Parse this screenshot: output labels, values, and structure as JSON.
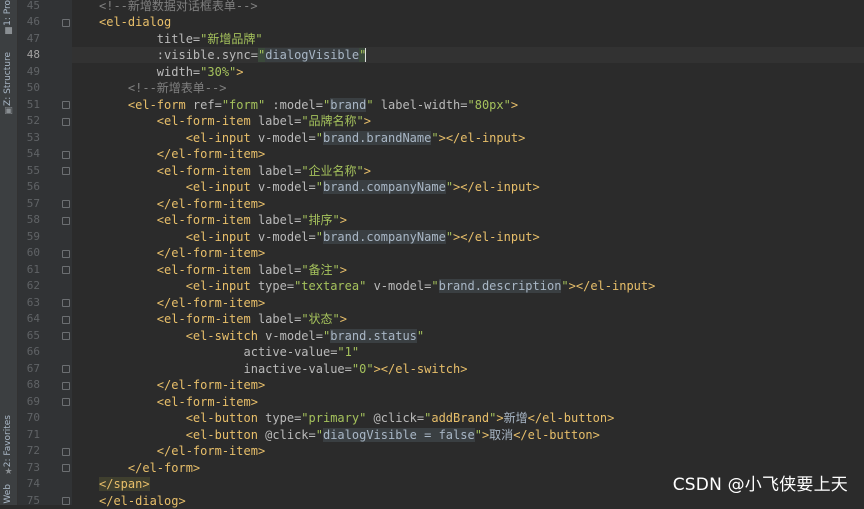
{
  "tool_windows": {
    "project": {
      "label": "1: Pro",
      "icon": "folder-icon"
    },
    "structure": {
      "label": "Z: Structure",
      "icon": "structure-icon"
    },
    "favorites": {
      "label": "2: Favorites",
      "icon": "star-icon"
    },
    "web": {
      "label": "Web",
      "icon": "web-icon"
    }
  },
  "editor": {
    "current_line": "48",
    "lines": [
      {
        "num": "45",
        "tokens": [
          {
            "c": "t-cmt",
            "t": "<!--新增数据对话框表单-->"
          }
        ]
      },
      {
        "num": "46",
        "tokens": [
          {
            "c": "t-tag",
            "t": "<el-dialog"
          }
        ]
      },
      {
        "num": "47",
        "tokens": [
          {
            "c": "t-attr",
            "t": "        title="
          },
          {
            "c": "t-val",
            "t": "\"新增品牌\""
          }
        ]
      },
      {
        "num": "48",
        "tokens": [
          {
            "c": "t-attr",
            "t": "        :visible.sync="
          },
          {
            "c": "t-val hl-val",
            "t": "\""
          },
          {
            "c": "hl-str",
            "t": "dialogVisible"
          },
          {
            "c": "t-val hl-val",
            "t": "\""
          },
          {
            "c": "caret",
            "t": ""
          }
        ]
      },
      {
        "num": "49",
        "tokens": [
          {
            "c": "t-attr",
            "t": "        width="
          },
          {
            "c": "t-val",
            "t": "\"30%\""
          },
          {
            "c": "t-tag",
            "t": ">"
          }
        ]
      },
      {
        "num": "50",
        "tokens": [
          {
            "c": "t-cmt",
            "t": "    <!--新增表单-->"
          }
        ]
      },
      {
        "num": "51",
        "tokens": [
          {
            "c": "t-tag",
            "t": "    <el-form "
          },
          {
            "c": "t-attr",
            "t": "ref="
          },
          {
            "c": "t-val",
            "t": "\"form\" "
          },
          {
            "c": "t-attr",
            "t": ":model="
          },
          {
            "c": "t-val",
            "t": "\""
          },
          {
            "c": "hl-str",
            "t": "brand"
          },
          {
            "c": "t-val",
            "t": "\" "
          },
          {
            "c": "t-attr",
            "t": "label-width="
          },
          {
            "c": "t-val",
            "t": "\"80px\""
          },
          {
            "c": "t-tag",
            "t": ">"
          }
        ]
      },
      {
        "num": "52",
        "tokens": [
          {
            "c": "t-tag",
            "t": "        <el-form-item "
          },
          {
            "c": "t-attr",
            "t": "label="
          },
          {
            "c": "t-val",
            "t": "\"品牌名称\""
          },
          {
            "c": "t-tag",
            "t": ">"
          }
        ]
      },
      {
        "num": "53",
        "tokens": [
          {
            "c": "t-tag",
            "t": "            <el-input "
          },
          {
            "c": "t-attr",
            "t": "v-model="
          },
          {
            "c": "t-val",
            "t": "\""
          },
          {
            "c": "hl-str",
            "t": "brand.brandName"
          },
          {
            "c": "t-val",
            "t": "\""
          },
          {
            "c": "t-tag",
            "t": "></el-input>"
          }
        ]
      },
      {
        "num": "54",
        "tokens": [
          {
            "c": "t-tag",
            "t": "        </el-form-item>"
          }
        ]
      },
      {
        "num": "55",
        "tokens": [
          {
            "c": "t-tag",
            "t": "        <el-form-item "
          },
          {
            "c": "t-attr",
            "t": "label="
          },
          {
            "c": "t-val",
            "t": "\"企业名称\""
          },
          {
            "c": "t-tag",
            "t": ">"
          }
        ]
      },
      {
        "num": "56",
        "tokens": [
          {
            "c": "t-tag",
            "t": "            <el-input "
          },
          {
            "c": "t-attr",
            "t": "v-model="
          },
          {
            "c": "t-val",
            "t": "\""
          },
          {
            "c": "hl-str",
            "t": "brand.companyName"
          },
          {
            "c": "t-val",
            "t": "\""
          },
          {
            "c": "t-tag",
            "t": "></el-input>"
          }
        ]
      },
      {
        "num": "57",
        "tokens": [
          {
            "c": "t-tag",
            "t": "        </el-form-item>"
          }
        ]
      },
      {
        "num": "58",
        "tokens": [
          {
            "c": "t-tag",
            "t": "        <el-form-item "
          },
          {
            "c": "t-attr",
            "t": "label="
          },
          {
            "c": "t-val",
            "t": "\"排序\""
          },
          {
            "c": "t-tag",
            "t": ">"
          }
        ]
      },
      {
        "num": "59",
        "tokens": [
          {
            "c": "t-tag",
            "t": "            <el-input "
          },
          {
            "c": "t-attr",
            "t": "v-model="
          },
          {
            "c": "t-val",
            "t": "\""
          },
          {
            "c": "hl-str",
            "t": "brand.companyName"
          },
          {
            "c": "t-val",
            "t": "\""
          },
          {
            "c": "t-tag",
            "t": "></el-input>"
          }
        ]
      },
      {
        "num": "60",
        "tokens": [
          {
            "c": "t-tag",
            "t": "        </el-form-item>"
          }
        ]
      },
      {
        "num": "61",
        "tokens": [
          {
            "c": "t-tag",
            "t": "        <el-form-item "
          },
          {
            "c": "t-attr",
            "t": "label="
          },
          {
            "c": "t-val",
            "t": "\"备注\""
          },
          {
            "c": "t-tag",
            "t": ">"
          }
        ]
      },
      {
        "num": "62",
        "tokens": [
          {
            "c": "t-tag",
            "t": "            <el-input "
          },
          {
            "c": "t-attr",
            "t": "type="
          },
          {
            "c": "t-val",
            "t": "\"textarea\" "
          },
          {
            "c": "t-attr",
            "t": "v-model="
          },
          {
            "c": "t-val",
            "t": "\""
          },
          {
            "c": "hl-str",
            "t": "brand.description"
          },
          {
            "c": "t-val",
            "t": "\""
          },
          {
            "c": "t-tag",
            "t": "></el-input>"
          }
        ]
      },
      {
        "num": "63",
        "tokens": [
          {
            "c": "t-tag",
            "t": "        </el-form-item>"
          }
        ]
      },
      {
        "num": "64",
        "tokens": [
          {
            "c": "t-tag",
            "t": "        <el-form-item "
          },
          {
            "c": "t-attr",
            "t": "label="
          },
          {
            "c": "t-val",
            "t": "\"状态\""
          },
          {
            "c": "t-tag",
            "t": ">"
          }
        ]
      },
      {
        "num": "65",
        "tokens": [
          {
            "c": "t-tag",
            "t": "            <el-switch "
          },
          {
            "c": "t-attr",
            "t": "v-model="
          },
          {
            "c": "t-val",
            "t": "\""
          },
          {
            "c": "hl-str",
            "t": "brand.status"
          },
          {
            "c": "t-val",
            "t": "\""
          }
        ]
      },
      {
        "num": "66",
        "tokens": [
          {
            "c": "t-attr",
            "t": "                    active-value="
          },
          {
            "c": "t-val",
            "t": "\"1\""
          }
        ]
      },
      {
        "num": "67",
        "tokens": [
          {
            "c": "t-attr",
            "t": "                    inactive-value="
          },
          {
            "c": "t-val",
            "t": "\"0\""
          },
          {
            "c": "t-tag",
            "t": "></el-switch>"
          }
        ]
      },
      {
        "num": "68",
        "tokens": [
          {
            "c": "t-tag",
            "t": "        </el-form-item>"
          }
        ]
      },
      {
        "num": "69",
        "tokens": [
          {
            "c": "t-tag",
            "t": "        <el-form-item>"
          }
        ]
      },
      {
        "num": "70",
        "tokens": [
          {
            "c": "t-tag",
            "t": "            <el-button "
          },
          {
            "c": "t-attr",
            "t": "type="
          },
          {
            "c": "t-val",
            "t": "\"primary\" "
          },
          {
            "c": "t-attr",
            "t": "@click="
          },
          {
            "c": "t-val",
            "t": "\""
          },
          {
            "c": "t-tag",
            "t": "addBrand"
          },
          {
            "c": "t-val",
            "t": "\""
          },
          {
            "c": "t-tag",
            "t": ">"
          },
          {
            "c": "t-txt",
            "t": "新增"
          },
          {
            "c": "t-tag",
            "t": "</el-button>"
          }
        ]
      },
      {
        "num": "71",
        "tokens": [
          {
            "c": "t-tag",
            "t": "            <el-button "
          },
          {
            "c": "t-attr",
            "t": "@click="
          },
          {
            "c": "t-val",
            "t": "\""
          },
          {
            "c": "hl-str",
            "t": "dialogVisible = false"
          },
          {
            "c": "t-val",
            "t": "\""
          },
          {
            "c": "t-tag",
            "t": ">"
          },
          {
            "c": "t-txt",
            "t": "取消"
          },
          {
            "c": "t-tag",
            "t": "</el-button>"
          }
        ]
      },
      {
        "num": "72",
        "tokens": [
          {
            "c": "t-tag",
            "t": "        </el-form-item>"
          }
        ]
      },
      {
        "num": "73",
        "tokens": [
          {
            "c": "t-tag",
            "t": "    </el-form>"
          }
        ]
      },
      {
        "num": "74",
        "tokens": [
          {
            "c": "hl-tag",
            "t": "</span>"
          }
        ]
      },
      {
        "num": "75",
        "tokens": [
          {
            "c": "t-tag",
            "t": "</el-dialog>"
          }
        ]
      }
    ]
  },
  "watermark": "CSDN @小飞侠要上天"
}
